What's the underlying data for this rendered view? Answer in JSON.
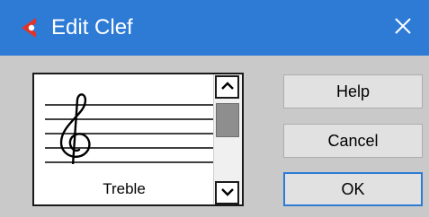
{
  "window": {
    "title": "Edit Clef",
    "app_icon": "cubase-logo-icon",
    "close_icon": "close-icon"
  },
  "preview": {
    "clef_symbol": "𝄞",
    "clef_name": "Treble",
    "scroll_up_icon": "chevron-up-icon",
    "scroll_down_icon": "chevron-down-icon"
  },
  "buttons": {
    "help": "Help",
    "cancel": "Cancel",
    "ok": "OK"
  },
  "colors": {
    "titlebar": "#2e7bd6",
    "body": "#c9c9c9",
    "accent_logo": "#e0342b"
  }
}
